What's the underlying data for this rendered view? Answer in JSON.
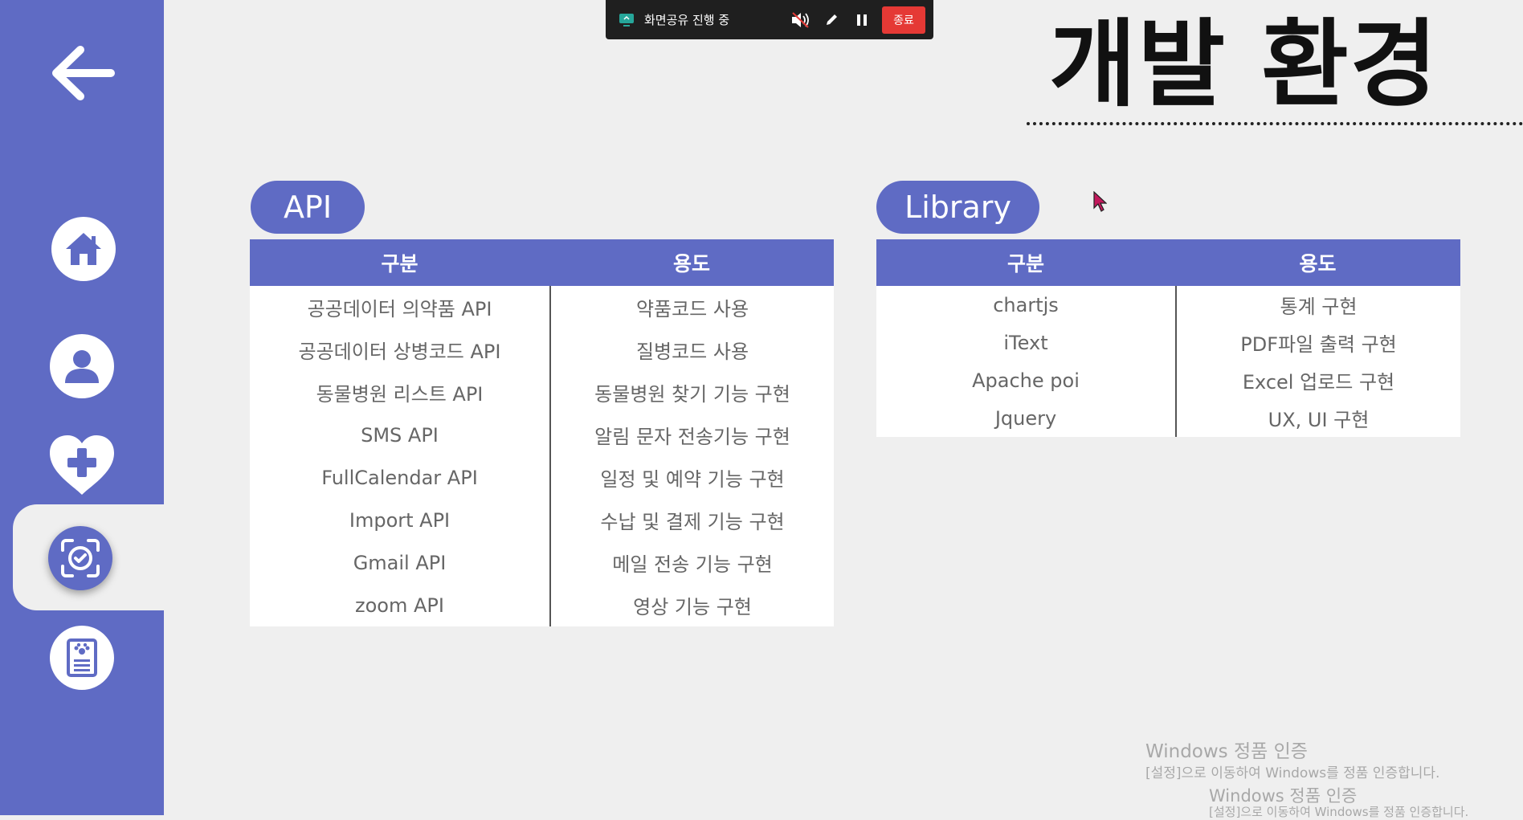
{
  "sidebar": {
    "items": [
      {
        "name": "back",
        "icon": "arrow-left-icon"
      },
      {
        "name": "home",
        "icon": "home-icon"
      },
      {
        "name": "user",
        "icon": "user-icon"
      },
      {
        "name": "health",
        "icon": "heart-plus-icon"
      },
      {
        "name": "scan",
        "icon": "scan-check-icon",
        "active": true
      },
      {
        "name": "record",
        "icon": "paw-document-icon"
      }
    ]
  },
  "share_bar": {
    "status_text": "화면공유 진행 중",
    "end_label": "종료"
  },
  "title": "개발 환경",
  "api": {
    "pill_label": "API",
    "headers": [
      "구분",
      "용도"
    ],
    "rows": [
      [
        "공공데이터 의약품 API",
        "약품코드 사용"
      ],
      [
        "공공데이터 상병코드 API",
        "질병코드 사용"
      ],
      [
        "동물병원 리스트 API",
        "동물병원 찾기 기능 구현"
      ],
      [
        "SMS API",
        "알림 문자 전송기능 구현"
      ],
      [
        "FullCalendar API",
        "일정 및 예약 기능 구현"
      ],
      [
        "Import API",
        "수납 및 결제 기능 구현"
      ],
      [
        "Gmail API",
        "메일 전송 기능 구현"
      ],
      [
        "zoom API",
        "영상 기능 구현"
      ]
    ]
  },
  "library": {
    "pill_label": "Library",
    "headers": [
      "구분",
      "용도"
    ],
    "rows": [
      [
        "chartjs",
        "통계 구현"
      ],
      [
        "iText",
        "PDF파일 출력 구현"
      ],
      [
        "Apache poi",
        "Excel 업로드 구현"
      ],
      [
        "Jquery",
        "UX, UI 구현"
      ]
    ]
  },
  "watermark": {
    "title": "Windows 정품 인증",
    "subtitle": "[설정]으로 이동하여 Windows를 정품 인증합니다."
  },
  "colors": {
    "accent": "#5f6bc4",
    "end_button": "#e53935"
  }
}
